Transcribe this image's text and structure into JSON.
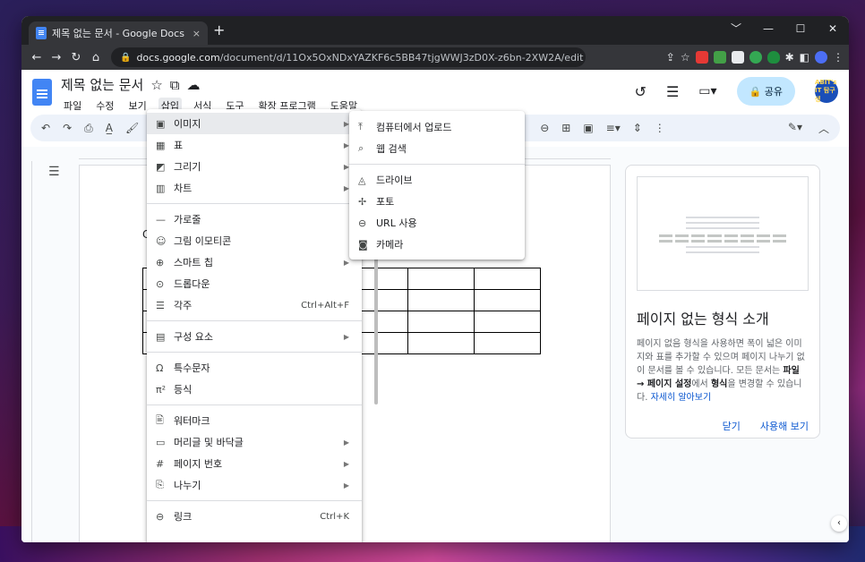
{
  "browser": {
    "tab_title": "제목 없는 문서 - Google Docs",
    "tab_close": "×",
    "new_tab": "+",
    "url_host": "docs.google.com",
    "url_path": "/document/d/11Ox5OxNDxYAZKF6c5BB47tjgWWJ3zD0X-z6bn-2XW2A/edit",
    "window_controls": [
      "﹀",
      "—",
      "☐",
      "✕"
    ]
  },
  "docs": {
    "title": "제목 없는 문서",
    "menubar": [
      "파일",
      "수정",
      "보기",
      "삽입",
      "서식",
      "도구",
      "확장 프로그램",
      "도움말"
    ],
    "share_label": "공유",
    "avatar_text": "ABIT's IT 탐구생",
    "body_letter": "C"
  },
  "insert_menu": {
    "items": [
      {
        "icon": "▣",
        "label": "이미지",
        "shortcut": "",
        "arrow": "▶"
      },
      {
        "icon": "▦",
        "label": "표",
        "shortcut": "",
        "arrow": "▶"
      },
      {
        "icon": "◩",
        "label": "그리기",
        "shortcut": "",
        "arrow": "▶"
      },
      {
        "icon": "▥",
        "label": "차트",
        "shortcut": "",
        "arrow": "▶"
      },
      {
        "icon": "—",
        "label": "가로줄",
        "shortcut": "",
        "arrow": ""
      },
      {
        "icon": "☺",
        "label": "그림 이모티콘",
        "shortcut": "",
        "arrow": ""
      },
      {
        "icon": "⊕",
        "label": "스마트 칩",
        "shortcut": "",
        "arrow": "▶"
      },
      {
        "icon": "⊙",
        "label": "드롭다운",
        "shortcut": "",
        "arrow": ""
      },
      {
        "icon": "☰",
        "label": "각주",
        "shortcut": "Ctrl+Alt+F",
        "arrow": ""
      },
      {
        "icon": "▤",
        "label": "구성 요소",
        "shortcut": "",
        "arrow": "▶"
      },
      {
        "icon": "Ω",
        "label": "특수문자",
        "shortcut": "",
        "arrow": ""
      },
      {
        "icon": "π²",
        "label": "등식",
        "shortcut": "",
        "arrow": ""
      },
      {
        "icon": "🖹",
        "label": "워터마크",
        "shortcut": "",
        "arrow": ""
      },
      {
        "icon": "▭",
        "label": "머리글 및 바닥글",
        "shortcut": "",
        "arrow": "▶"
      },
      {
        "icon": "#",
        "label": "페이지 번호",
        "shortcut": "",
        "arrow": "▶"
      },
      {
        "icon": "⎘",
        "label": "나누기",
        "shortcut": "",
        "arrow": "▶"
      },
      {
        "icon": "⊖",
        "label": "링크",
        "shortcut": "Ctrl+K",
        "arrow": ""
      }
    ]
  },
  "image_submenu": {
    "items": [
      {
        "icon": "⤒",
        "label": "컴퓨터에서 업로드"
      },
      {
        "icon": "⌕",
        "label": "웹 검색"
      },
      {
        "icon": "◬",
        "label": "드라이브"
      },
      {
        "icon": "✢",
        "label": "포토"
      },
      {
        "icon": "⊖",
        "label": "URL 사용"
      },
      {
        "icon": "◙",
        "label": "카메라"
      }
    ]
  },
  "panel": {
    "title": "페이지 없는 형식 소개",
    "text_1": "페이지 없음 형식을 사용하면 폭이 넓은 이미지와 표를 추가할 수 있으며 페이지 나누기 없이 문서를 볼 수 있습니다. 모든 문서는 ",
    "bold_1": "파일 → 페이지 설정",
    "text_2": "에서 ",
    "bold_2": "형식",
    "text_3": "을 변경할 수 있습니다. ",
    "link": "자세히 알아보기",
    "close_label": "닫기",
    "use_label": "사용해 보기"
  },
  "colors": {
    "accent": "#0b57d0",
    "share_bg": "#c2e7ff",
    "toolbar_bg": "#edf2fa",
    "docs_blue": "#4285f4"
  }
}
